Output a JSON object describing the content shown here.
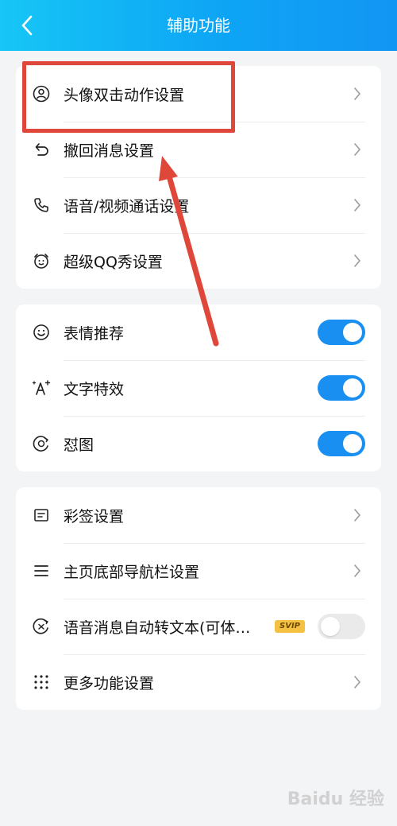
{
  "header": {
    "title": "辅助功能",
    "back_icon": "chevron-left-icon"
  },
  "group1": {
    "items": [
      {
        "label": "头像双击动作设置",
        "icon": "avatar-circle-icon"
      },
      {
        "label": "撤回消息设置",
        "icon": "undo-icon"
      },
      {
        "label": "语音/视频通话设置",
        "icon": "phone-icon"
      },
      {
        "label": "超级QQ秀设置",
        "icon": "alarm-face-icon"
      }
    ]
  },
  "group2": {
    "items": [
      {
        "label": "表情推荐",
        "icon": "smile-icon",
        "toggle_on": true
      },
      {
        "label": "文字特效",
        "icon": "text-sparkle-icon",
        "toggle_on": true
      },
      {
        "label": "怼图",
        "icon": "sticker-face-icon",
        "toggle_on": true
      }
    ]
  },
  "group3": {
    "items": [
      {
        "label": "彩签设置",
        "icon": "tag-card-icon"
      },
      {
        "label": "主页底部导航栏设置",
        "icon": "menu-lines-icon"
      },
      {
        "label": "语音消息自动转文本(可体…",
        "icon": "voice-to-text-icon",
        "badge": "SVIP",
        "toggle_on": false
      },
      {
        "label": "更多功能设置",
        "icon": "grid-dots-icon"
      }
    ]
  },
  "colors": {
    "header_start": "#16c6f5",
    "header_end": "#1296f4",
    "toggle_on": "#1a8ff2",
    "toggle_off": "#eaeaea",
    "annotation": "#e0473b",
    "badge": "#f5c143"
  },
  "annotation": {
    "box_target": "头像双击动作设置",
    "arrow_icon": "arrow-up-icon"
  },
  "watermark": {
    "text": "Baidu 经验"
  }
}
